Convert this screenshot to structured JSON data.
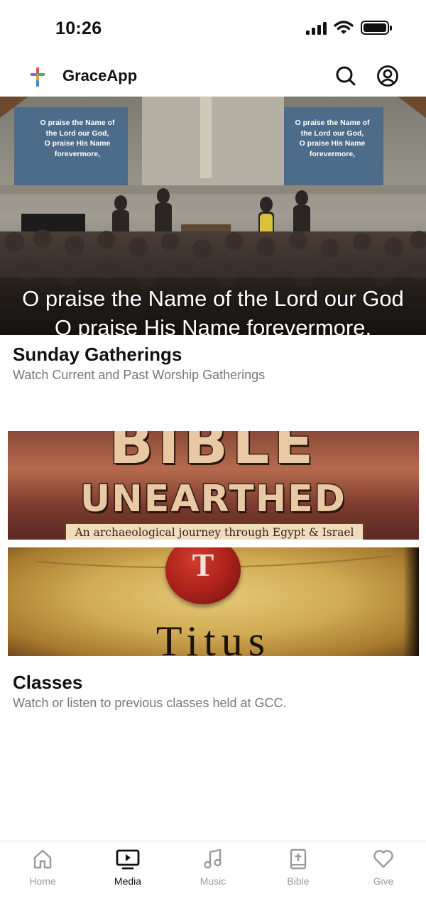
{
  "status": {
    "time": "10:26"
  },
  "header": {
    "title": "GraceApp",
    "search_icon": "search-icon",
    "account_icon": "account-icon"
  },
  "hero": {
    "screen_text_left": "O praise the Name of\nthe Lord our God,\nO praise His Name\nforevermore,",
    "screen_text_right": "O praise the Name of\nthe Lord our God,\nO praise His Name\nforevermore,",
    "caption_line1": "O praise the Name of the Lord our God",
    "caption_line2": "O praise His Name forevermore,"
  },
  "sunday": {
    "title": "Sunday Gatherings",
    "subtitle": "Watch Current and Past Worship Gatherings"
  },
  "banners": {
    "bible_title": "BIBLE",
    "bible_subtitle": "UNEARTHED",
    "bible_tagline": "An archaeological journey through Egypt & Israel",
    "titus_seal_letter": "T",
    "titus_title": "Titus"
  },
  "classes": {
    "title": "Classes",
    "subtitle": "Watch or listen to previous classes held at GCC."
  },
  "tabs": [
    {
      "label": "Home",
      "icon": "home-icon",
      "active": false
    },
    {
      "label": "Media",
      "icon": "media-icon",
      "active": true
    },
    {
      "label": "Music",
      "icon": "music-icon",
      "active": false
    },
    {
      "label": "Bible",
      "icon": "bible-icon",
      "active": false
    },
    {
      "label": "Give",
      "icon": "heart-icon",
      "active": false
    }
  ],
  "colors": {
    "accent": "#111111",
    "inactive": "#9a9a9a",
    "text_secondary": "#777777"
  }
}
